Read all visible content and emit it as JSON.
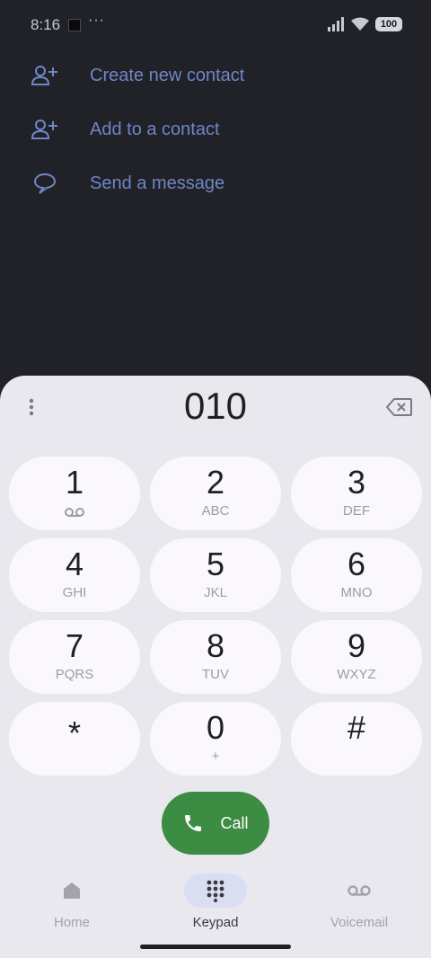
{
  "status_bar": {
    "time": "8:16",
    "dots": "···",
    "battery": "100"
  },
  "actions": [
    {
      "label": "Create new contact",
      "icon": "add-person-icon"
    },
    {
      "label": "Add to a contact",
      "icon": "add-person-icon"
    },
    {
      "label": "Send a message",
      "icon": "message-bubble-icon"
    }
  ],
  "dialpad": {
    "entered_number": "010",
    "keys": [
      {
        "digit": "1",
        "sub": "",
        "sub_icon": "voicemail-icon"
      },
      {
        "digit": "2",
        "sub": "ABC"
      },
      {
        "digit": "3",
        "sub": "DEF"
      },
      {
        "digit": "4",
        "sub": "GHI"
      },
      {
        "digit": "5",
        "sub": "JKL"
      },
      {
        "digit": "6",
        "sub": "MNO"
      },
      {
        "digit": "7",
        "sub": "PQRS"
      },
      {
        "digit": "8",
        "sub": "TUV"
      },
      {
        "digit": "9",
        "sub": "WXYZ"
      },
      {
        "digit": "*",
        "sub": ""
      },
      {
        "digit": "0",
        "sub": "+"
      },
      {
        "digit": "#",
        "sub": ""
      }
    ],
    "call_label": "Call"
  },
  "nav": {
    "items": [
      {
        "label": "Home",
        "icon": "home-icon",
        "active": false
      },
      {
        "label": "Keypad",
        "icon": "keypad-icon",
        "active": true
      },
      {
        "label": "Voicemail",
        "icon": "voicemail-icon",
        "active": false
      }
    ]
  },
  "colors": {
    "background": "#202228",
    "accent_text": "#6f86c6",
    "sheet": "#e8e8ee",
    "key": "#faf8fd",
    "call": "#3c8c43",
    "nav_active_pill": "#d9def2"
  }
}
